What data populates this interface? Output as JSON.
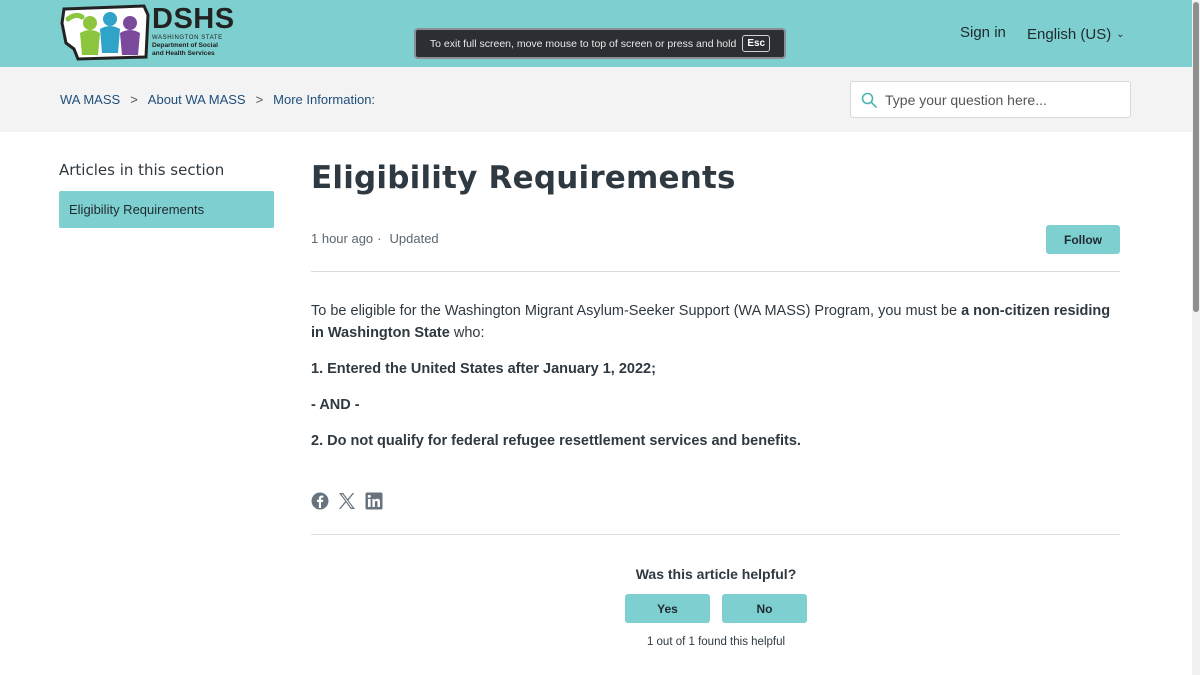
{
  "header": {
    "logo": {
      "name": "DSHS",
      "line1": "WASHINGTON STATE",
      "line2": "Department of Social",
      "line3": "and Health Services"
    },
    "fullscreen_notice": "To exit full screen, move mouse to top of screen or press and hold",
    "fullscreen_key": "Esc",
    "sign_in": "Sign in",
    "language": "English (US)"
  },
  "breadcrumb": [
    "WA MASS",
    "About WA MASS",
    "More Information:"
  ],
  "breadcrumb_separator": ">",
  "search": {
    "placeholder": "Type your question here..."
  },
  "sidebar": {
    "title": "Articles in this section",
    "items": [
      {
        "label": "Eligibility Requirements",
        "active": true
      }
    ]
  },
  "article": {
    "title": "Eligibility Requirements",
    "time": "1 hour ago",
    "meta_sep": "·",
    "status": "Updated",
    "follow_label": "Follow",
    "intro_plain": "To be eligible for the Washington Migrant Asylum-Seeker Support (WA MASS) Program, you must be ",
    "intro_bold": "a non-citizen residing in Washington State",
    "intro_tail": " who:",
    "point1": "1. Entered the United States after January 1, 2022;",
    "and": "- AND -",
    "point2": "2. Do not qualify for federal refugee resettlement services and benefits."
  },
  "share_icons": [
    "facebook-icon",
    "x-icon",
    "linkedin-icon"
  ],
  "feedback": {
    "question": "Was this article helpful?",
    "yes": "Yes",
    "no": "No",
    "count": "1 out of 1 found this helpful"
  },
  "colors": {
    "brand_teal": "#7ecfcf",
    "link": "#1f4e79",
    "text": "#2f3941"
  }
}
